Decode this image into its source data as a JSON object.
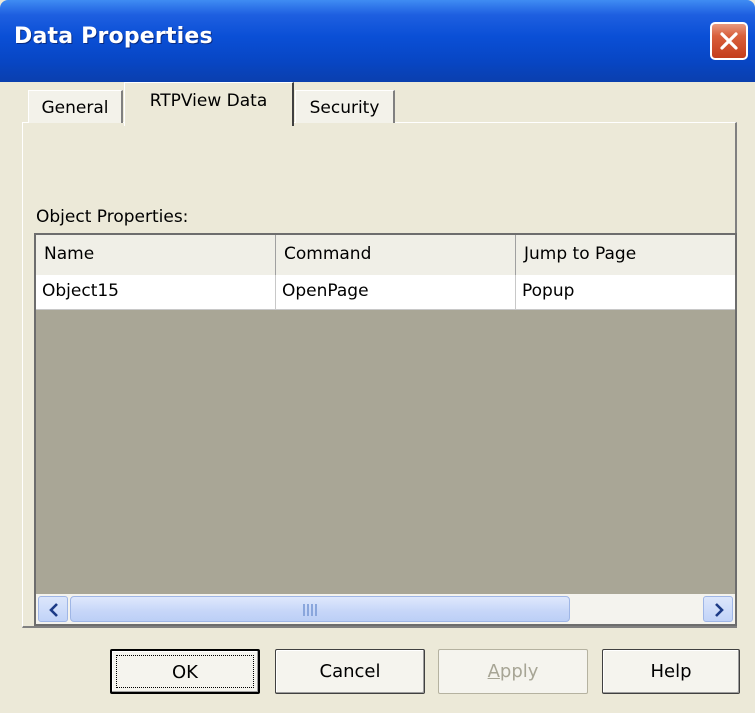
{
  "window": {
    "title": "Data Properties"
  },
  "tabs": [
    {
      "label": "General",
      "active": false
    },
    {
      "label": "RTPView Data",
      "active": true
    },
    {
      "label": "Security",
      "active": false
    }
  ],
  "panel": {
    "section_label": "Object Properties:",
    "table": {
      "columns": [
        "Name",
        "Command",
        "Jump to Page"
      ],
      "rows": [
        [
          "Object15",
          "OpenPage",
          "Popup"
        ]
      ]
    },
    "scrollbar": {
      "left_icon": "scroll-left-arrow-icon",
      "right_icon": "scroll-right-arrow-icon"
    }
  },
  "buttons": {
    "ok": "OK",
    "cancel": "Cancel",
    "apply_accel": "A",
    "apply_rest": "pply",
    "help": "Help"
  },
  "colors": {
    "titlebar": "#0a4fd6",
    "close": "#d9603c",
    "dialog_bg": "#ece9d8",
    "grid_empty": "#a9a696"
  }
}
